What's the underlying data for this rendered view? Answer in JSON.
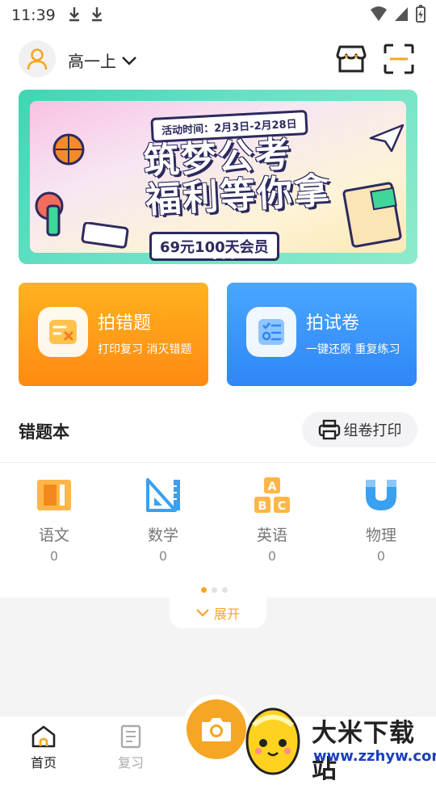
{
  "status_bar": {
    "time": "11:39"
  },
  "header": {
    "grade": "高一上"
  },
  "banner": {
    "time_label": "活动时间：2月3日-2月28日",
    "title_line1": "筑梦公考",
    "title_line2": "福利等你拿",
    "promo": "69元100天会员"
  },
  "cards": [
    {
      "title": "拍错题",
      "subtitle": "打印复习 消灭错题",
      "color": "#ff9a18"
    },
    {
      "title": "拍试卷",
      "subtitle": "一键还原 重复练习",
      "color": "#3b95fa"
    }
  ],
  "wrongbook": {
    "title": "错题本",
    "print_label": "组卷打印"
  },
  "subjects": [
    {
      "name": "语文",
      "count": "0",
      "icon": "book-icon"
    },
    {
      "name": "数学",
      "count": "0",
      "icon": "ruler-triangle-icon"
    },
    {
      "name": "英语",
      "count": "0",
      "icon": "abc-blocks-icon"
    },
    {
      "name": "物理",
      "count": "0",
      "icon": "magnet-icon"
    }
  ],
  "expand_label": "展开",
  "tabbar": {
    "home": "首页",
    "review": "复习"
  },
  "watermark": {
    "name": "大米下载站",
    "url": "www.zzhyw.com"
  },
  "colors": {
    "accent": "#f5a623",
    "orange_card": "#ff9a18",
    "blue_card": "#3b95fa"
  }
}
